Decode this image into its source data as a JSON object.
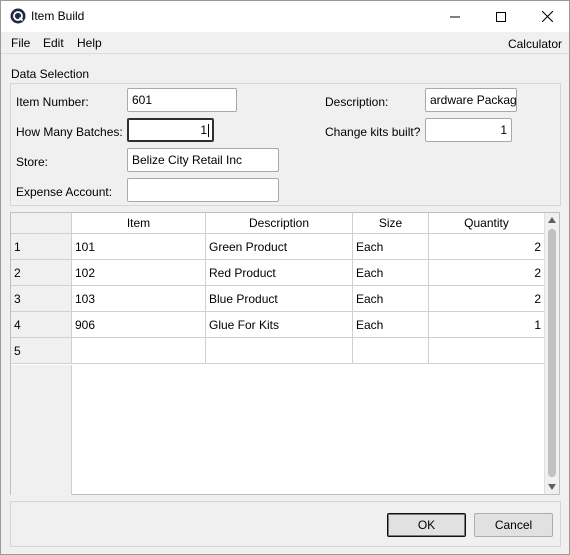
{
  "window": {
    "title": "Item Build",
    "icon": "app-logo-icon"
  },
  "menu": {
    "file": "File",
    "edit": "Edit",
    "help": "Help",
    "calculator": "Calculator"
  },
  "data_selection": {
    "group_label": "Data Selection",
    "item_number_label": "Item Number:",
    "item_number_value": "601",
    "description_label": "Description:",
    "description_value": "ardware Package",
    "batches_label": "How Many Batches:",
    "batches_value": "1",
    "change_kits_label": "Change kits built?",
    "change_kits_value": "1",
    "store_label": "Store:",
    "store_value": "Belize City Retail Inc",
    "expense_label": "Expense Account:",
    "expense_value": ""
  },
  "grid": {
    "columns": [
      "Item",
      "Description",
      "Size",
      "Quantity"
    ],
    "rows": [
      {
        "num": "1",
        "item": "101",
        "description": "Green Product",
        "size": "Each",
        "quantity": "2"
      },
      {
        "num": "2",
        "item": "102",
        "description": "Red Product",
        "size": "Each",
        "quantity": "2"
      },
      {
        "num": "3",
        "item": "103",
        "description": "Blue Product",
        "size": "Each",
        "quantity": "2"
      },
      {
        "num": "4",
        "item": "906",
        "description": "Glue For Kits",
        "size": "Each",
        "quantity": "1"
      },
      {
        "num": "5",
        "item": "",
        "description": "",
        "size": "",
        "quantity": ""
      }
    ]
  },
  "buttons": {
    "ok": "OK",
    "cancel": "Cancel"
  }
}
